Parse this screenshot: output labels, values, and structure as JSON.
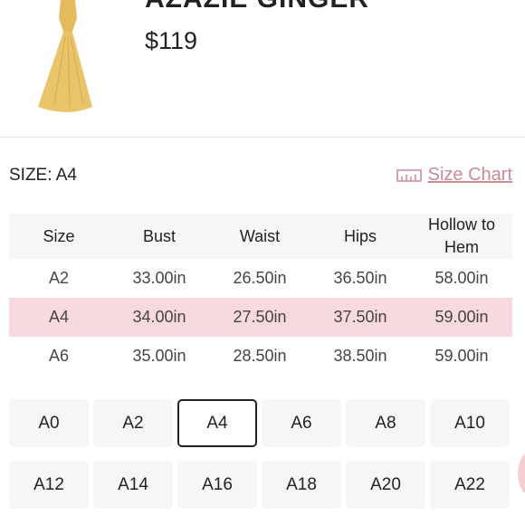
{
  "product": {
    "name": "AZAZIE GINGER",
    "price": "$119",
    "image_icon": "dress-image",
    "image_color": "#e9c46a"
  },
  "size_selector": {
    "label": "SIZE: A4",
    "chart_link": "Size Chart",
    "chart_icon": "ruler-icon",
    "accent_color": "#c98a95",
    "highlight_color": "#f7d9df"
  },
  "size_table": {
    "headers": [
      "Size",
      "Bust",
      "Waist",
      "Hips",
      "Hollow to Hem"
    ],
    "rows": [
      [
        "A2",
        "33.00in",
        "26.50in",
        "36.50in",
        "58.00in"
      ],
      [
        "A4",
        "34.00in",
        "27.50in",
        "37.50in",
        "59.00in"
      ],
      [
        "A6",
        "35.00in",
        "28.50in",
        "38.50in",
        "59.00in"
      ]
    ],
    "selected_row": "A4"
  },
  "size_options": {
    "selected": "A4",
    "items": [
      "A0",
      "A2",
      "A4",
      "A6",
      "A8",
      "A10",
      "A12",
      "A14",
      "A16",
      "A18",
      "A20",
      "A22"
    ]
  }
}
